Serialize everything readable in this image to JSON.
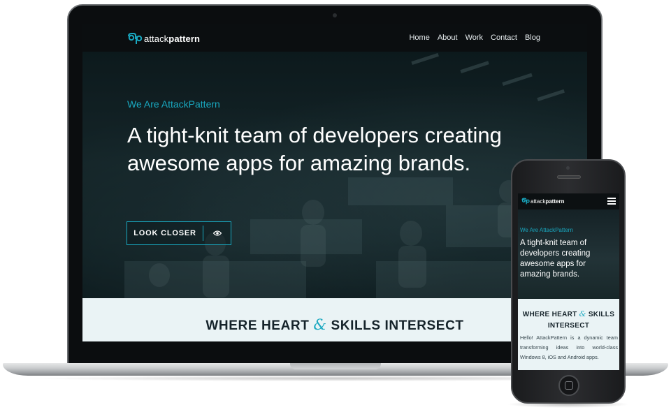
{
  "site": {
    "logo_text_1": "attack",
    "logo_text_2": "pattern",
    "brand_color": "#19a8c0"
  },
  "nav": {
    "items": [
      {
        "label": "Home"
      },
      {
        "label": "About"
      },
      {
        "label": "Work"
      },
      {
        "label": "Contact"
      },
      {
        "label": "Blog"
      }
    ]
  },
  "hero": {
    "eyebrow": "We Are AttackPattern",
    "headline": "A tight-knit team of developers creating awesome apps for amazing brands.",
    "cta_label": "LOOK CLOSER",
    "cta_icon": "eye-icon"
  },
  "intro": {
    "title_part1": "WHERE HEART",
    "title_amp": "&",
    "title_part2": "SKILLS INTERSECT"
  },
  "phone": {
    "logo_text_1": "attack",
    "logo_text_2": "pattern",
    "menu_icon": "hamburger-icon",
    "eyebrow": "We Are AttackPattern",
    "headline": "A tight-knit team of developers creating awesome apps for amazing brands.",
    "intro_title_part1": "WHERE HEART",
    "intro_title_amp": "&",
    "intro_title_part2": "SKILLS INTERSECT",
    "intro_text": "Hello! AttackPattern is a dynamic team transforming ideas into world-class Windows 8, iOS and Android apps."
  }
}
